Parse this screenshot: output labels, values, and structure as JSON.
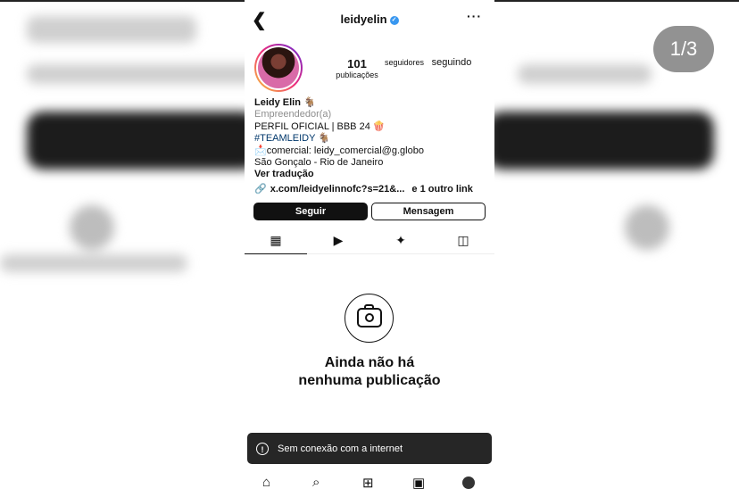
{
  "viewer": {
    "counter": "1/3"
  },
  "profile": {
    "username": "leidyelin",
    "verified_icon": "verified-badge-icon",
    "back_icon": "chevron-left-icon",
    "more_icon": "ellipsis-icon",
    "stats": {
      "posts_count": "101",
      "posts_label": "publicações",
      "followers_label": "seguidores",
      "following_label": "seguindo"
    },
    "bio": {
      "name": "Leidy Elin 🐐",
      "category": "Empreendedor(a)",
      "line1": "PERFIL OFICIAL | BBB 24 🍿",
      "hashtag": "#TEAMLEIDY 🐐",
      "contact": "📩comercial: leidy_comercial@g.globo",
      "location": "São Gonçalo - Rio de Janeiro",
      "translate": "Ver tradução",
      "link": "x.com/leidyelinnofc?s=21&...",
      "more_links": "e 1 outro link"
    },
    "actions": {
      "follow": "Seguir",
      "message": "Mensagem"
    },
    "tabs": [
      "grid-icon",
      "reels-icon",
      "sparkles-icon",
      "tagged-icon"
    ]
  },
  "empty_state": {
    "line1": "Ainda não há",
    "line2": "nenhuma publicação"
  },
  "toast": {
    "message": "Sem conexão com a internet"
  },
  "bottom_nav": [
    "home-icon",
    "search-icon",
    "new-post-icon",
    "reels-icon",
    "profile-avatar"
  ],
  "colors": {
    "follow_button": "#111111",
    "hashtag": "#00376b",
    "verified": "#3897f0"
  }
}
